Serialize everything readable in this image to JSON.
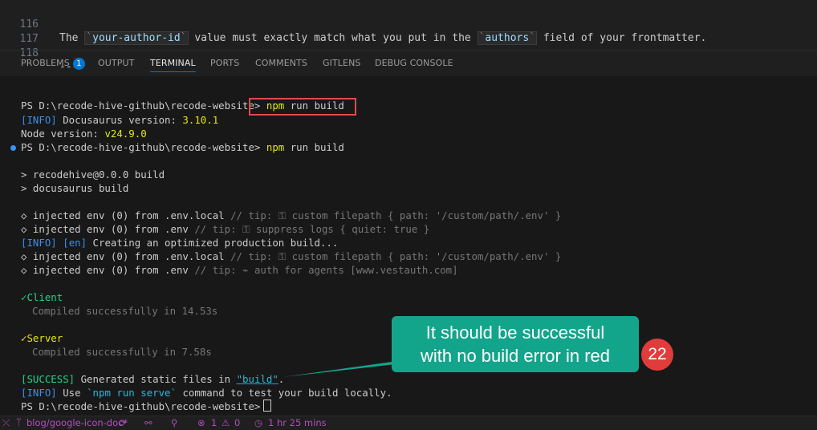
{
  "editor": {
    "lines": [
      {
        "number": "116",
        "pre": "The ",
        "code1": "your-author-id",
        "mid": " value must exactly match what you put in the ",
        "code2": "authors",
        "post": " field of your frontmatter."
      },
      {
        "number": "117",
        "text": ""
      },
      {
        "number": "118",
        "text": "---"
      }
    ]
  },
  "panel": {
    "tabs": [
      {
        "label": "PROBLEMS",
        "badge": "1"
      },
      {
        "label": "OUTPUT"
      },
      {
        "label": "TERMINAL",
        "active": true
      },
      {
        "label": "PORTS"
      },
      {
        "label": "COMMENTS"
      },
      {
        "label": "GITLENS"
      },
      {
        "label": "DEBUG CONSOLE"
      }
    ]
  },
  "terminal": {
    "prompt": "PS D:\\recode-hive-github\\recode-website>",
    "cmd_npm": "npm",
    "cmd_rest": " run build",
    "info_tag": "[INFO]",
    "docusaurus_label": " Docusaurus version: ",
    "docusaurus_version": "3.10.1",
    "node_label": "Node version: ",
    "node_version": "v24.9.0",
    "script_line1": "> recodehive@0.0.0 build",
    "script_line2": "> docusaurus build",
    "inj1_main": "◇ injected env (0) from .env.local ",
    "inj1_tip": "// tip: ⚿ custom filepath { path: '/custom/path/.env' }",
    "inj2_main": "◇ injected env (0) from .env ",
    "inj2_tip": "// tip: ⚿ suppress logs { quiet: true }",
    "en_tag": "[en]",
    "creating": " Creating an optimized production build...",
    "inj3_main": "◇ injected env (0) from .env.local ",
    "inj3_tip": "// tip: ⚿ custom filepath { path: '/custom/path/.env' }",
    "inj4_main": "◇ injected env (0) from .env ",
    "inj4_tip": "// tip: ⌁ auth for agents [www.vestauth.com]",
    "client_check": "✓",
    "client_label": "Client",
    "client_compiled": "Compiled successfully in 14.53s",
    "server_check": "✓",
    "server_label": "Server",
    "server_compiled": "Compiled successfully in 7.58s",
    "success_tag": "[SUCCESS]",
    "success_text": " Generated static files in ",
    "success_dir": "\"build\"",
    "success_end": ".",
    "use_text": " Use ",
    "use_cmd": "`npm run serve`",
    "use_rest": " command to test your build locally."
  },
  "callout": {
    "line1": "It should be successful",
    "line2": "with no build error in red",
    "step_number": "22"
  },
  "statusbar": {
    "branch": "blog/google-icon-doc*",
    "errors": "1",
    "warnings": "0",
    "time": "1 hr 25 mins"
  },
  "colors": {
    "accent": "#0078d4",
    "callout": "#13a58b",
    "step_badge": "#e03c3c",
    "highlight_box": "#e5484d"
  }
}
